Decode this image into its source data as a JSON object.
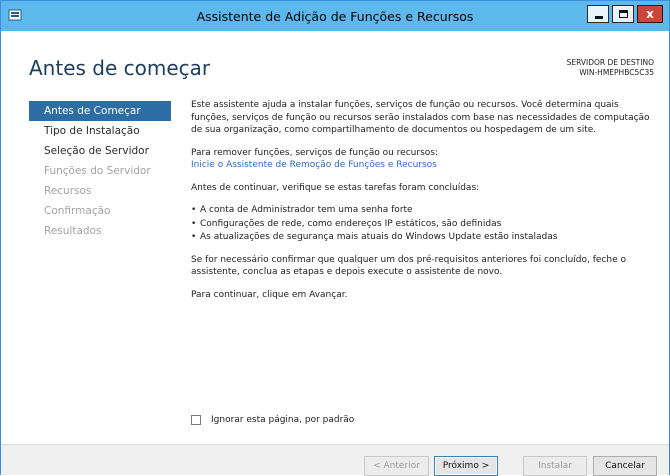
{
  "window": {
    "title": "Assistente de Adição de Funções e Recursos",
    "minimize_icon": "minimize-icon",
    "maximize_icon": "maximize-icon",
    "close_glyph": "x"
  },
  "header": {
    "page_title": "Antes de começar",
    "destination_label": "SERVIDOR DE DESTINO",
    "destination_server": "WIN-HMEPHBC5C35"
  },
  "nav": {
    "items": [
      {
        "label": "Antes de Começar",
        "state": "active"
      },
      {
        "label": "Tipo de Instalação",
        "state": "enabled"
      },
      {
        "label": "Seleção de Servidor",
        "state": "enabled"
      },
      {
        "label": "Funções do Servidor",
        "state": "disabled"
      },
      {
        "label": "Recursos",
        "state": "disabled"
      },
      {
        "label": "Confirmação",
        "state": "disabled"
      },
      {
        "label": "Resultados",
        "state": "disabled"
      }
    ]
  },
  "content": {
    "intro": "Este assistente ajuda a instalar funções, serviços de função ou recursos. Você determina quais funções, serviços de função ou recursos serão instalados com base nas necessidades de computação de sua organização, como compartilhamento de documentos ou hospedagem de um site.",
    "remove_label": "Para remover funções, serviços de função ou recursos:",
    "remove_link": "Inicie o Assistente de Remoção de Funções e Recursos",
    "verify_label": "Antes de continuar, verifique se estas tarefas foram concluídas:",
    "bullets": [
      "A conta de Administrador tem uma senha forte",
      "Configurações de rede, como endereços IP estáticos, são definidas",
      "As atualizações de segurança mais atuais do Windows Update estão instaladas"
    ],
    "prereq_note": "Se for necessário confirmar que qualquer um dos pré-requisitos anteriores foi concluído, feche o assistente, conclua as etapas e depois execute o assistente de novo.",
    "continue_note": "Para continuar, clique em Avançar."
  },
  "skip_checkbox": {
    "label": "Ignorar esta página, por padrão",
    "checked": false
  },
  "footer": {
    "previous": "< Anterior",
    "next": "Próximo >",
    "install": "Instalar",
    "cancel": "Cancelar"
  },
  "colors": {
    "titlebar": "#5db8eb",
    "nav_active": "#2e6da4",
    "link": "#2f6bc3"
  }
}
